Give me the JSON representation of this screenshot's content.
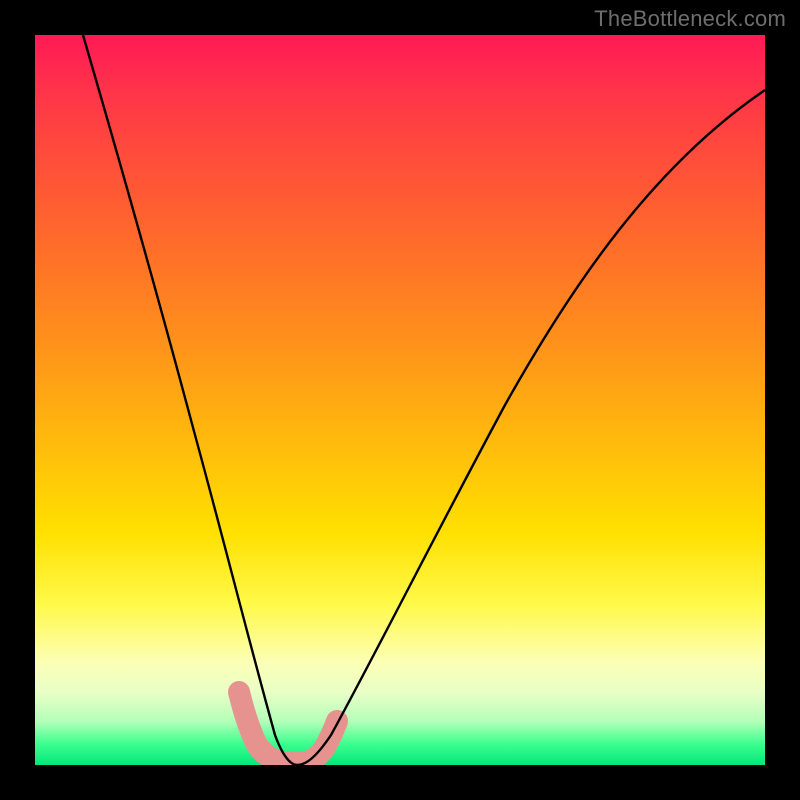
{
  "watermark": {
    "text": "TheBottleneck.com"
  },
  "chart_data": {
    "type": "line",
    "title": "",
    "xlabel": "",
    "ylabel": "",
    "xlim": [
      0,
      100
    ],
    "ylim": [
      0,
      100
    ],
    "grid": false,
    "background_gradient": {
      "direction": "vertical",
      "stops": [
        {
          "pos": 0,
          "color": "#ff1a55"
        },
        {
          "pos": 50,
          "color": "#ffb000"
        },
        {
          "pos": 80,
          "color": "#fff94a"
        },
        {
          "pos": 100,
          "color": "#00e87a"
        }
      ]
    },
    "series": [
      {
        "name": "bottleneck-curve",
        "color": "#000000",
        "stroke_width": 2,
        "x": [
          7,
          10,
          14,
          18,
          22,
          25,
          27,
          29,
          31,
          33,
          35,
          39,
          45,
          52,
          60,
          68,
          76,
          84,
          92,
          100
        ],
        "values": [
          100,
          88,
          74,
          60,
          46,
          34,
          24,
          14,
          6,
          1,
          0,
          1,
          6,
          14,
          24,
          36,
          50,
          64,
          78,
          90
        ]
      },
      {
        "name": "highlight-band",
        "color": "#e6938f",
        "stroke_width": 14,
        "stroke_linecap": "round",
        "x": [
          28,
          30,
          32,
          34,
          36,
          38,
          40
        ],
        "values": [
          10,
          4,
          1,
          0,
          0,
          1,
          5
        ]
      }
    ]
  }
}
